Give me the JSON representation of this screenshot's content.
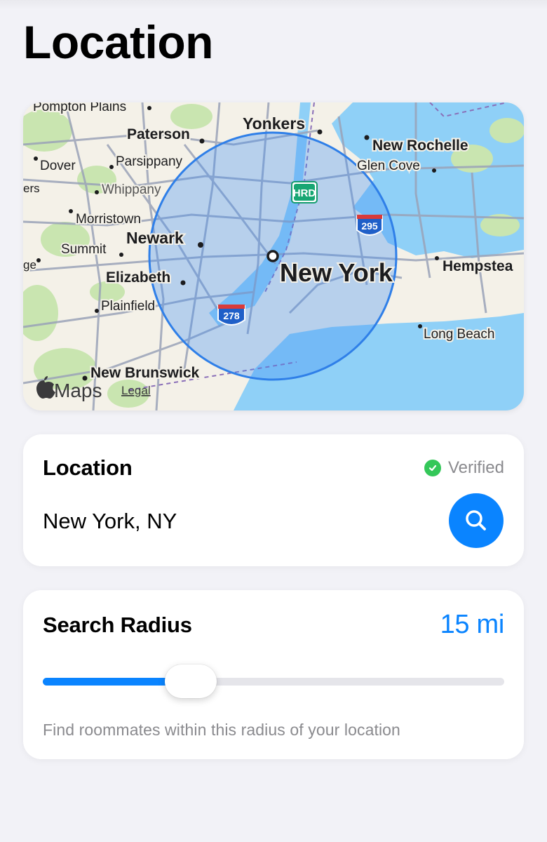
{
  "page": {
    "title": "Location"
  },
  "map": {
    "labels": {
      "pompton": "Pompton Plains",
      "paterson": "Paterson",
      "yonkers": "Yonkers",
      "new_rochelle": "New Rochelle",
      "dover": "Dover",
      "parsippany": "Parsippany",
      "glen_cove": "Glen Cove",
      "ers": "ers",
      "whippany": "Whippany",
      "morristown": "Morristown",
      "summit": "Summit",
      "newark": "Newark",
      "ge": "ge",
      "new_york": "New York",
      "hempstead": "Hempstea",
      "elizabeth": "Elizabeth",
      "plainfield": "Plainfield",
      "long_beach": "Long Beach",
      "new_brunswick": "New Brunswick",
      "shield_hrd": "HRD",
      "shield_295": "295",
      "shield_278": "278",
      "brand": "Maps",
      "legal": "Legal"
    },
    "colors": {
      "water": "#8fd0f7",
      "land": "#f4f1e8",
      "park": "#c9e5b0",
      "radius": "#3d8ef5"
    }
  },
  "location_card": {
    "heading": "Location",
    "status": "Verified",
    "value": "New York, NY",
    "search_icon": "search-icon"
  },
  "radius_card": {
    "heading": "Search Radius",
    "value_label": "15 mi",
    "slider_fraction": 0.32,
    "hint": "Find roommates within this radius of your location"
  },
  "colors": {
    "accent": "#0a84ff",
    "verified": "#34c759",
    "background": "#f2f2f7"
  }
}
